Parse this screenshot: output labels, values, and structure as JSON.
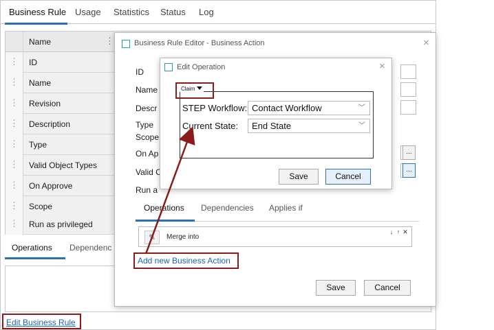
{
  "top_tabs": [
    {
      "label": "Business Rule",
      "active": true
    },
    {
      "label": "Usage",
      "active": false
    },
    {
      "label": "Statistics",
      "active": false
    },
    {
      "label": "Status",
      "active": false
    },
    {
      "label": "Log",
      "active": false
    }
  ],
  "grid": {
    "header": "Name",
    "rows": [
      "ID",
      "Name",
      "Revision",
      "Description",
      "Type",
      "Valid Object Types",
      "On Approve",
      "Scope",
      "Run as privileged"
    ]
  },
  "bottom_tabs": [
    {
      "label": "Operations",
      "active": true
    },
    {
      "label": "Dependenc",
      "active": false
    }
  ],
  "edit_link": "Edit Business Rule",
  "dialog1": {
    "title": "Business Rule Editor - Business Action",
    "close": "×",
    "labels": [
      "ID",
      "Name",
      "Descr",
      "Type",
      "Scope",
      "On Ap",
      "Valid C",
      "Run a"
    ],
    "ellipsis": "...",
    "tabs": [
      {
        "label": "Operations",
        "active": true
      },
      {
        "label": "Dependencies",
        "active": false
      },
      {
        "label": "Applies if",
        "active": false
      }
    ],
    "operation_label": "Merge into",
    "op_down": "↓",
    "op_up": "↑",
    "op_remove": "✕",
    "add_link": "Add new Business Action",
    "save": "Save",
    "cancel": "Cancel"
  },
  "dialog2": {
    "title": "Edit Operation",
    "close": "×",
    "legend": "Claim",
    "fields": [
      {
        "label": "STEP Workflow:",
        "value": "Contact Workflow"
      },
      {
        "label": "Current State:",
        "value": "End State"
      }
    ],
    "chevron": "﹀",
    "save": "Save",
    "cancel": "Cancel"
  },
  "colors": {
    "accent": "#2b6fb6",
    "link": "#1a64b8",
    "highlight": "#8b1a1a",
    "dialog_icon": "#1fa0b0"
  },
  "icons": [
    "dialog-icon",
    "close-icon",
    "pencil-icon",
    "kebab-icon",
    "drag-handle-icon",
    "chevron-down-icon",
    "arrow-annotation-icon"
  ]
}
